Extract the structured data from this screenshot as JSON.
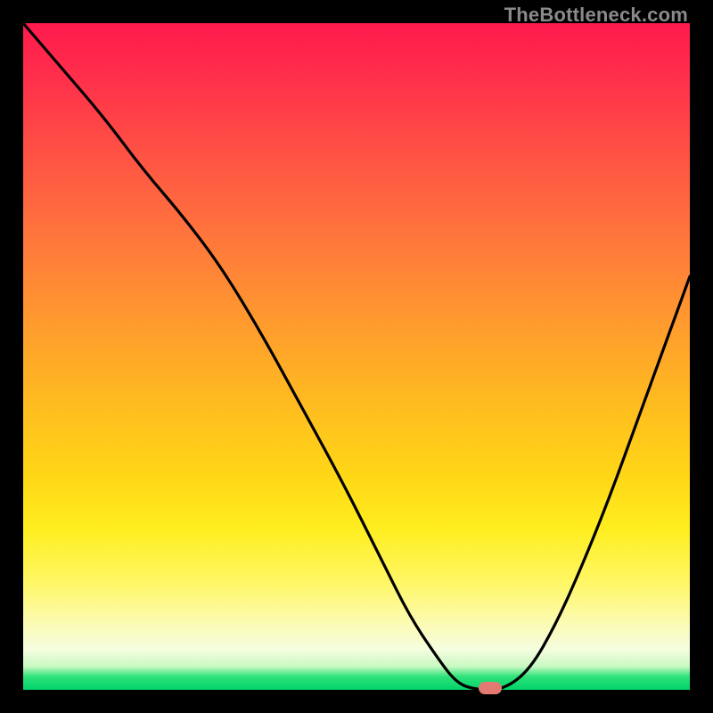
{
  "watermark": "TheBottleneck.com",
  "colors": {
    "frame": "#000000",
    "curve": "#000000",
    "marker": "#e37a72"
  },
  "chart_data": {
    "type": "line",
    "title": "",
    "xlabel": "",
    "ylabel": "",
    "xlim": [
      0,
      100
    ],
    "ylim": [
      0,
      100
    ],
    "x": [
      0,
      6,
      12,
      18,
      24,
      30,
      36,
      42,
      48,
      54,
      58,
      62,
      65,
      68,
      72,
      76,
      80,
      84,
      88,
      92,
      96,
      100
    ],
    "values": [
      100,
      93,
      86,
      78,
      71,
      63,
      53,
      42,
      31,
      19,
      11,
      5,
      1,
      0,
      0,
      3,
      10,
      19,
      29,
      40,
      51,
      62
    ],
    "marker": {
      "x": 70,
      "y": 0
    },
    "grid": false,
    "legend": false
  }
}
